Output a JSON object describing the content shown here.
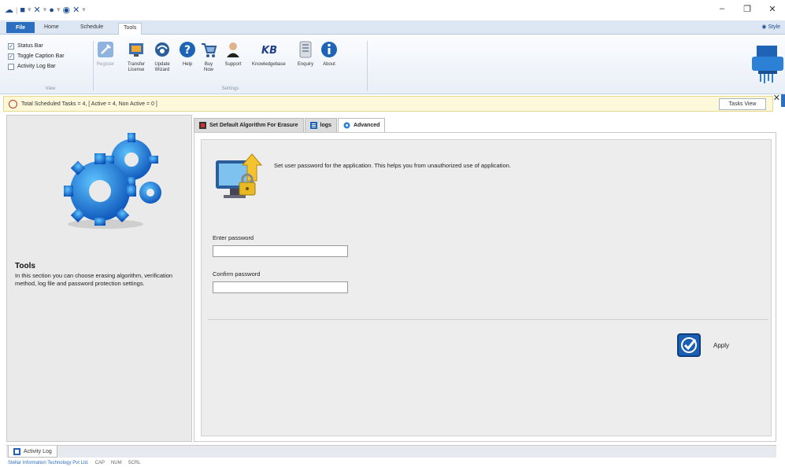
{
  "window": {
    "qat_icons": [
      "save-icon",
      "stop-icon",
      "erase-icon",
      "settings-icon",
      "close-icon"
    ],
    "controls": [
      "–",
      "❐",
      "✕"
    ]
  },
  "ribbon": {
    "file_label": "File",
    "tabs": [
      "Home",
      "Schedule",
      "Tools"
    ],
    "active_tab": "Tools",
    "style_label": "Style",
    "view_group": {
      "items": [
        {
          "label": "Status Bar",
          "checked": true
        },
        {
          "label": "Toggle Caption Bar",
          "checked": true
        },
        {
          "label": "Activity Log Bar",
          "checked": false
        }
      ],
      "group_label": "View"
    },
    "settings_group": {
      "buttons": [
        {
          "label": "Register",
          "icon": "register-icon",
          "enabled": false
        },
        {
          "label": "Transfer License",
          "icon": "transfer-license-icon",
          "enabled": true
        },
        {
          "label": "Update Wizard",
          "icon": "update-icon",
          "enabled": true
        },
        {
          "label": "Help",
          "icon": "help-icon",
          "enabled": true
        },
        {
          "label": "Buy Now",
          "icon": "cart-icon",
          "enabled": true
        },
        {
          "label": "Support",
          "icon": "support-icon",
          "enabled": true
        },
        {
          "label": "Knowledgebase",
          "icon": "kb-icon",
          "enabled": true
        },
        {
          "label": "Enquiry",
          "icon": "enquiry-icon",
          "enabled": true
        },
        {
          "label": "About",
          "icon": "info-icon",
          "enabled": true
        }
      ],
      "group_label": "Settings"
    }
  },
  "notification": {
    "text": "Total Scheduled Tasks = 4, [ Active = 4, Non Active = 0 ]",
    "tasks_view_label": "Tasks View"
  },
  "left_panel": {
    "title": "Tools",
    "description": "In this section you can choose erasing algorithm, verification method, log file and password protection settings."
  },
  "content_tabs": [
    {
      "label": "Set Default Algorithm For Erasure",
      "active": false
    },
    {
      "label": "logs",
      "active": false
    },
    {
      "label": "Advanced",
      "active": true
    }
  ],
  "advanced": {
    "description": "Set user password for the application. This helps you from unauthorized use of application.",
    "enter_password_label": "Enter password",
    "confirm_password_label": "Confirm password",
    "enter_password_value": "",
    "confirm_password_value": "",
    "apply_label": "Apply"
  },
  "bottom": {
    "activity_tab": "Activity Log",
    "status_company": "Stellar Information Technology Pvt Ltd.",
    "status_keys": [
      "CAP",
      "NUM",
      "SCRL"
    ]
  },
  "colors": {
    "accent": "#2c6fc1",
    "notify_bg": "#fdf8da"
  }
}
